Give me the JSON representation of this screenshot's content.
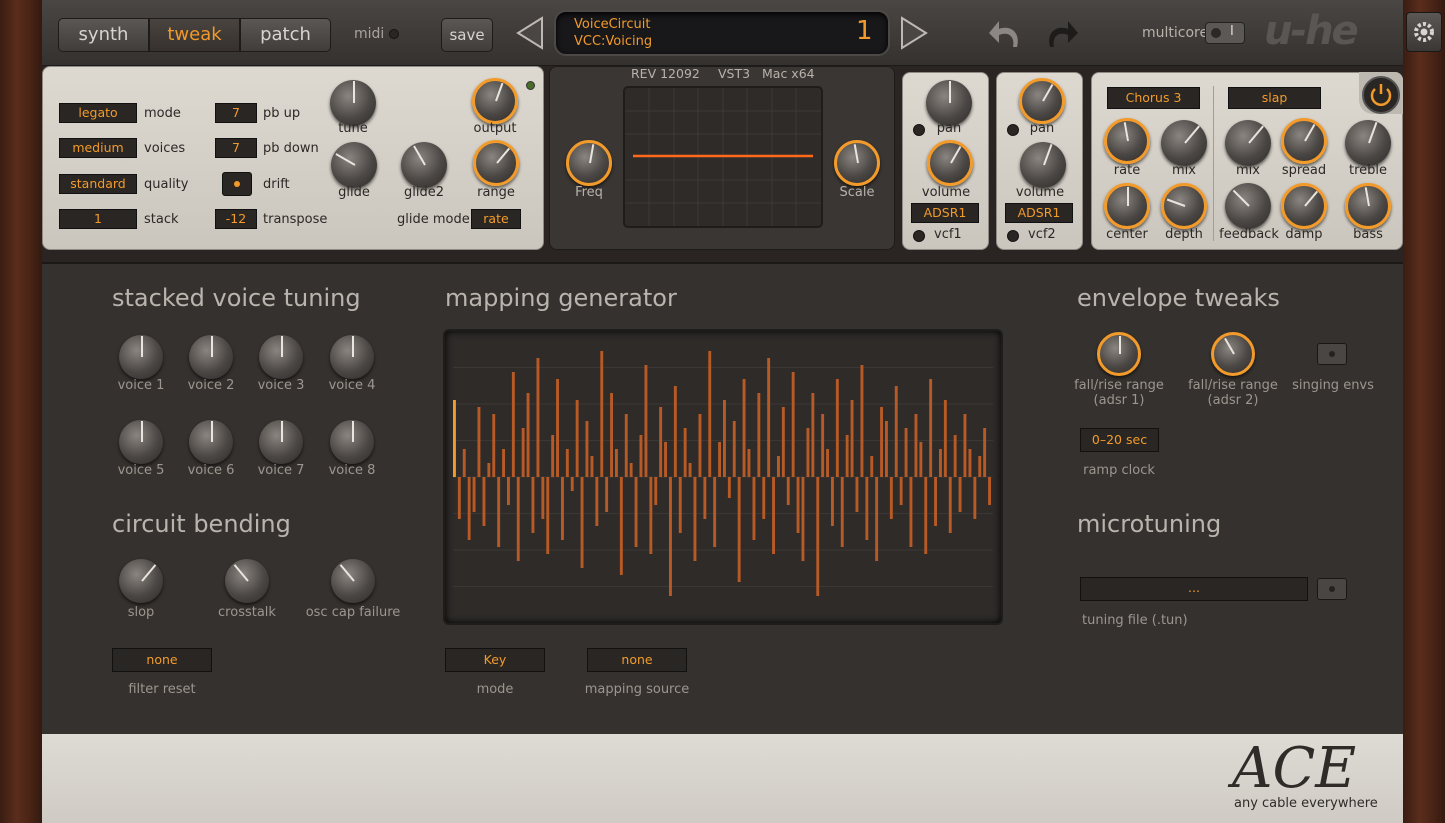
{
  "topbar": {
    "tabs": [
      {
        "label": "synth"
      },
      {
        "label": "tweak"
      },
      {
        "label": "patch"
      }
    ],
    "midi_label": "midi",
    "save_label": "save",
    "preset_line1": "VoiceCircuit",
    "preset_line2": "VCC:Voicing",
    "preset_number": "1",
    "multicore_label": "multicore",
    "multicore_toggle": "I",
    "logo": "u-he"
  },
  "global": {
    "mode_value": "legato",
    "mode_label": "mode",
    "voices_value": "medium",
    "voices_label": "voices",
    "quality_value": "standard",
    "quality_label": "quality",
    "stack_value": "1",
    "stack_label": "stack",
    "pbup_value": "7",
    "pbup_label": "pb up",
    "pbdown_value": "7",
    "pbdown_label": "pb down",
    "drift_label": "drift",
    "transpose_value": "-12",
    "transpose_label": "transpose",
    "tune_label": "tune",
    "output_label": "output",
    "glide_label": "glide",
    "glide2_label": "glide2",
    "range_label": "range",
    "glidemode_label": "glide mode",
    "glidemode_value": "rate"
  },
  "scope": {
    "rev": "REV 12092",
    "format": "VST3",
    "platform": "Mac x64",
    "freq_label": "Freq",
    "scale_label": "Scale"
  },
  "amp1": {
    "pan": "pan",
    "volume": "volume",
    "env": "ADSR1",
    "vcf": "vcf1"
  },
  "amp2": {
    "pan": "pan",
    "volume": "volume",
    "env": "ADSR1",
    "vcf": "vcf2"
  },
  "fx": {
    "chorus_value": "Chorus 3",
    "rate": "rate",
    "mix1": "mix",
    "center": "center",
    "depth": "depth",
    "delay_value": "slap",
    "mix2": "mix",
    "spread": "spread",
    "feedback": "feedback",
    "damp": "damp",
    "treble": "treble",
    "bass": "bass"
  },
  "stacked": {
    "title": "stacked voice tuning",
    "voices": [
      "voice 1",
      "voice 2",
      "voice 3",
      "voice 4",
      "voice 5",
      "voice 6",
      "voice 7",
      "voice 8"
    ]
  },
  "circuit": {
    "title": "circuit bending",
    "slop": "slop",
    "crosstalk": "crosstalk",
    "capfail": "osc cap failure",
    "filter_reset_value": "none",
    "filter_reset_label": "filter reset"
  },
  "mapping": {
    "title": "mapping generator",
    "mode_value": "Key",
    "mode_label": "mode",
    "source_value": "none",
    "source_label": "mapping source",
    "bars": [
      0.55,
      -0.3,
      0.2,
      -0.45,
      -0.25,
      0.5,
      -0.35,
      0.1,
      0.45,
      -0.5,
      0.2,
      -0.2,
      0.75,
      -0.6,
      0.35,
      0.6,
      -0.4,
      0.85,
      -0.3,
      -0.55,
      0.3,
      0.7,
      -0.45,
      0.2,
      -0.1,
      0.55,
      -0.65,
      0.4,
      0.15,
      -0.35,
      0.9,
      -0.25,
      0.6,
      0.2,
      -0.7,
      0.45,
      0.1,
      -0.5,
      0.3,
      0.8,
      -0.55,
      -0.2,
      0.5,
      0.25,
      -0.85,
      0.65,
      -0.4,
      0.35,
      0.1,
      -0.6,
      0.45,
      -0.3,
      0.9,
      -0.5,
      0.25,
      0.55,
      -0.15,
      0.4,
      -0.75,
      0.7,
      0.2,
      -0.45,
      0.6,
      -0.3,
      0.85,
      -0.55,
      0.15,
      0.5,
      -0.2,
      0.75,
      -0.4,
      -0.6,
      0.35,
      0.6,
      -0.85,
      0.45,
      0.2,
      -0.35,
      0.7,
      -0.5,
      0.3,
      0.55,
      -0.25,
      0.8,
      -0.45,
      0.15,
      -0.6,
      0.5,
      0.4,
      -0.3,
      0.65,
      -0.2,
      0.35,
      -0.5,
      0.45,
      0.25,
      -0.55,
      0.7,
      -0.35,
      0.2,
      0.55,
      -0.4,
      0.3,
      -0.25,
      0.45,
      0.2,
      -0.3,
      0.15,
      0.35,
      -0.2
    ]
  },
  "envelope": {
    "title": "envelope tweaks",
    "adsr1_line1": "fall/rise range",
    "adsr1_line2": "(adsr 1)",
    "adsr2_line1": "fall/rise range",
    "adsr2_line2": "(adsr 2)",
    "singing": "singing envs",
    "ramp_value": "0–20 sec",
    "ramp_label": "ramp clock"
  },
  "microtuning": {
    "title": "microtuning",
    "file_value": "...",
    "file_label": "tuning file (.tun)"
  },
  "footer": {
    "brand": "ACE",
    "tagline": "any cable everywhere"
  },
  "colors": {
    "accent": "#f29b2b",
    "bar": "#b85a26",
    "panel": "#d6d2ca",
    "dark": "#35312e"
  }
}
